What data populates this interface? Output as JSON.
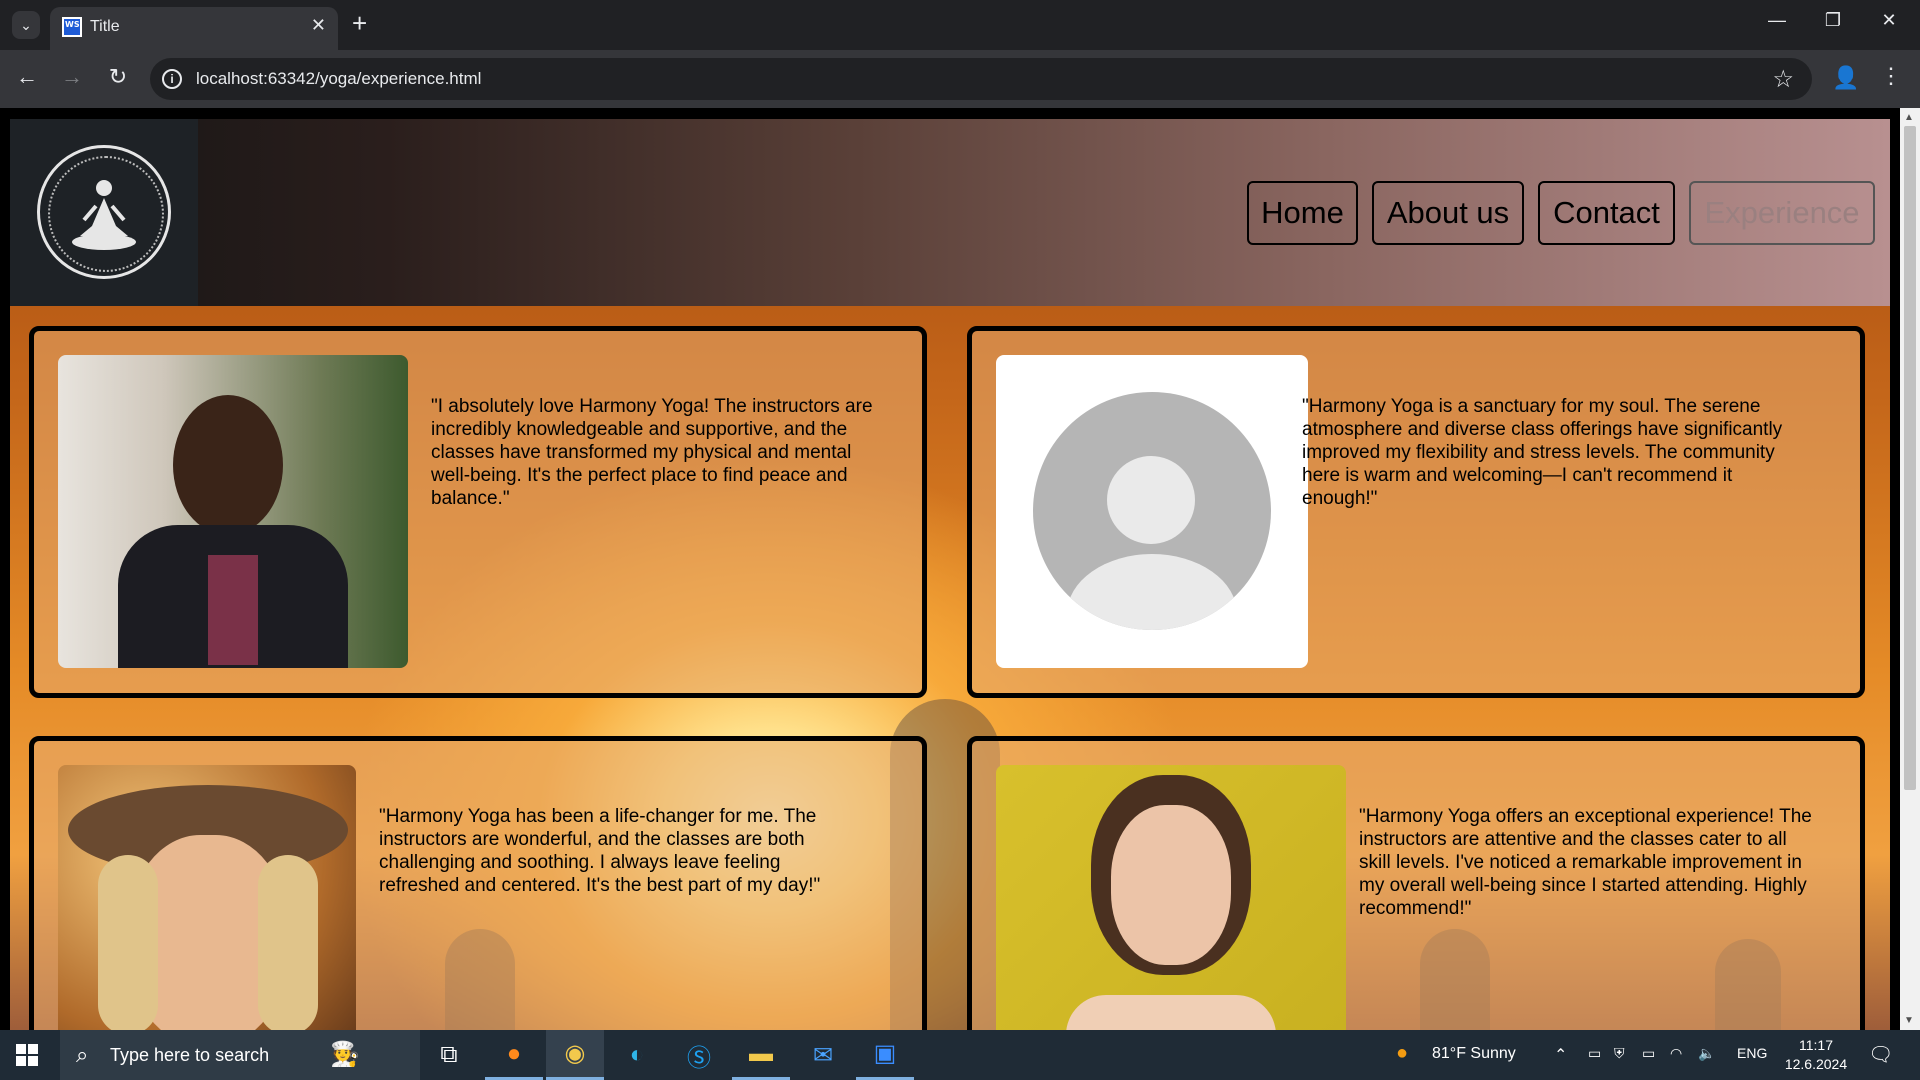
{
  "browser": {
    "tab_title": "Title",
    "url": "localhost:63342/yoga/experience.html",
    "favicon_text": "WS"
  },
  "site": {
    "nav": [
      {
        "label": "Home"
      },
      {
        "label": "About us"
      },
      {
        "label": "Contact"
      },
      {
        "label": "Experience",
        "active": true
      }
    ],
    "testimonials": [
      {
        "quote": "\"I absolutely love Harmony Yoga! The instructors are incredibly knowledgeable and supportive, and the classes have transformed my physical and mental well-being. It's the perfect place to find peace and balance.\"",
        "photo": "man-portrait"
      },
      {
        "quote": "\"Harmony Yoga is a sanctuary for my soul. The serene atmosphere and diverse class offerings have significantly improved my flexibility and stress levels. The community here is warm and welcoming—I can't recommend it enough!\"",
        "photo": "default-avatar"
      },
      {
        "quote": "\"Harmony Yoga has been a life-changer for me. The instructors are wonderful, and the classes are both challenging and soothing. I always leave feeling refreshed and centered. It's the best part of my day!\"",
        "photo": "woman-hat-portrait"
      },
      {
        "quote": "\"Harmony Yoga offers an exceptional experience! The instructors are attentive and the classes cater to all skill levels. I've noticed a remarkable improvement in my overall well-being since I started attending. Highly recommend!\"",
        "photo": "woman-portrait"
      }
    ]
  },
  "taskbar": {
    "search_placeholder": "Type here to search",
    "weather": "81°F  Sunny",
    "language": "ENG",
    "time": "11:17",
    "date": "12.6.2024"
  },
  "colors": {
    "chrome_dark": "#202124",
    "chrome_mid": "#35363a",
    "taskbar": "#1f2b36"
  }
}
